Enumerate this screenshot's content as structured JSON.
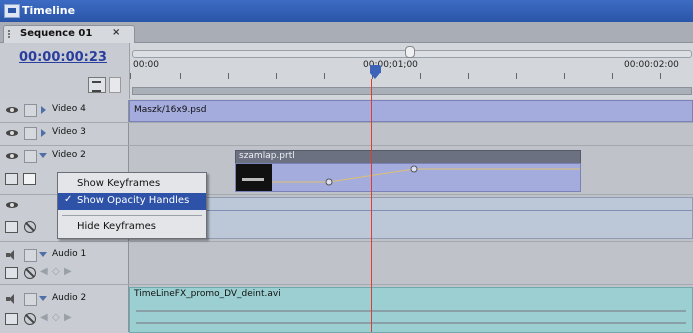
{
  "window": {
    "title": "Timeline"
  },
  "tab": {
    "label": "Sequence 01",
    "close": "×"
  },
  "timecode": "00:00:00:23",
  "ruler": {
    "labels": [
      "00:00",
      "00;00;01;00",
      "00:00:02:00"
    ]
  },
  "tracks": {
    "video4": {
      "name": "Video 4",
      "clip": "Maszk/16x9.psd"
    },
    "video3": {
      "name": "Video 3"
    },
    "video2": {
      "name": "Video 2",
      "clip": "szamlap.prtl"
    },
    "audio1": {
      "name": "Audio 1"
    },
    "audio2": {
      "name": "Audio 2",
      "clip": "TimeLineFX_promo_DV_deint.avi"
    }
  },
  "context_menu": {
    "items": [
      {
        "label": "Show Keyframes",
        "checked": false
      },
      {
        "label": "Show Opacity Handles",
        "checked": true
      },
      {
        "label": "Hide Keyframes",
        "checked": false
      }
    ],
    "checkmark": "✓"
  },
  "colors": {
    "accent": "#2d52a8",
    "playhead": "#e23c2e",
    "video_clip": "#a4abdd",
    "audio_clip": "#9ccfd1"
  }
}
